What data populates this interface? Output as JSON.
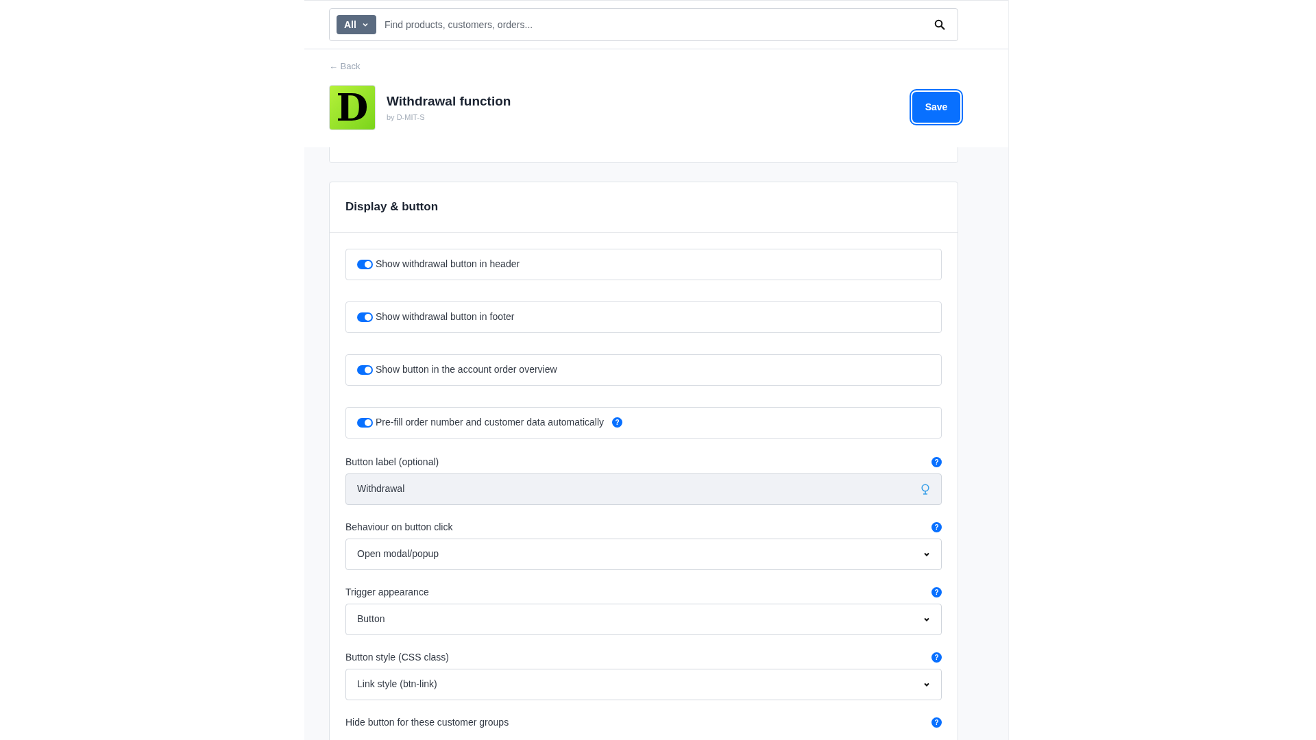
{
  "search": {
    "scope": "All",
    "placeholder": "Find products, customers, orders..."
  },
  "back": "← Back",
  "app": {
    "title": "Withdrawal function",
    "vendor": "by D-MIT-S",
    "logo_letter": "D"
  },
  "save": "Save",
  "section": {
    "title": "Display & button",
    "toggles": [
      {
        "label": "Show withdrawal button in header",
        "on": true
      },
      {
        "label": "Show withdrawal button in footer",
        "on": true
      },
      {
        "label": "Show button in the account order overview",
        "on": true
      },
      {
        "label": "Pre-fill order number and customer data automatically",
        "on": true,
        "help_icon": "?"
      }
    ],
    "fields": [
      {
        "kind": "text",
        "label": "Button label (optional)",
        "value": "Withdrawal",
        "help_icon": "?"
      },
      {
        "kind": "select",
        "label": "Behaviour on button click",
        "value": "Open modal/popup",
        "help_icon": "?"
      },
      {
        "kind": "select",
        "label": "Trigger appearance",
        "value": "Button",
        "help_icon": "?"
      },
      {
        "kind": "select",
        "label": "Button style (CSS class)",
        "value": "Link style (btn-link)",
        "help_icon": "?"
      },
      {
        "kind": "label",
        "label": "Hide button for these customer groups",
        "help_icon": "?"
      }
    ]
  }
}
